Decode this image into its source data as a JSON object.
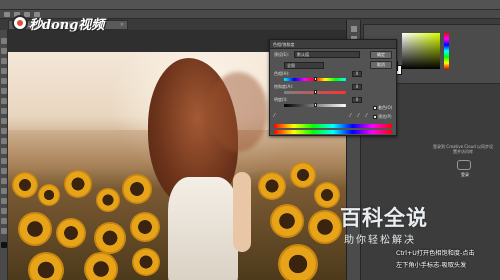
{
  "document": {
    "tab_label": "ps1.jpg @ 66.7% (RGB/8)",
    "close_glyph": "×"
  },
  "logo": {
    "text": "秒dong视频"
  },
  "dialog": {
    "title": "色相/饱和度",
    "preset_label": "预设(E):",
    "preset_value": "默认值",
    "ok_label": "确定",
    "cancel_label": "取消",
    "channel_value": "全图",
    "hue_label": "色相(H):",
    "hue_value": "0",
    "saturation_label": "饱和度(A):",
    "saturation_value": "0",
    "lightness_label": "明度(I):",
    "lightness_value": "0",
    "colorize_label": "着色(O)",
    "preview_label": "预览(P)",
    "eyedrop_glyph": "⁄"
  },
  "right_panel": {
    "creative_cloud_text": "登录到 Creative Cloud 以同步设置并访问库",
    "creative_cloud_button": "登录"
  },
  "watermark": {
    "brand": "百科全说",
    "tagline": "助你轻松解决"
  },
  "caption": {
    "line1": "Ctrl+U打开色相饱和度-点击",
    "line2": "左下角小手标志-吸取头发"
  },
  "colors": {
    "foreground_swatch": "#d8e60a",
    "background_swatch": "#ffffff",
    "dialog_bg": "#535353",
    "panel_bg": "#3c3c3c"
  }
}
